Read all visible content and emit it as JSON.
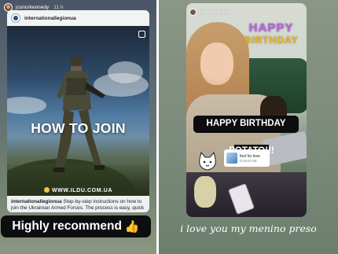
{
  "left_story": {
    "username": "jconorkennedy",
    "time": "11 h",
    "post": {
      "account": "internationallegionua",
      "headline": "HOW TO JOIN",
      "url": "WWW.ILDU.COM.UA",
      "caption_handle": "internationallegionua",
      "caption_text": " Step-by-step instructions on how to join the Ukrainian Armed Forces. The process is easy, quick and str..."
    },
    "sticker_text": "Highly recommend",
    "sticker_emoji": "👍"
  },
  "right_story": {
    "username": "jconorkennedy",
    "balloon_line1": "HAPPY",
    "balloon_line2": "BIRTHDAY",
    "sticker_line1": "HAPPY BIRTHDAY",
    "sticker_line2": "POTATO!!!",
    "music_title": "fool for love",
    "music_artist": "GUSJA SE",
    "caption": "i love you my menino preso"
  },
  "colors": {
    "sticker_bg": "#0e0e10",
    "thumb": "#f3c13a",
    "balloon_purple": "#b36bd8",
    "balloon_gold": "#e6b63a"
  }
}
